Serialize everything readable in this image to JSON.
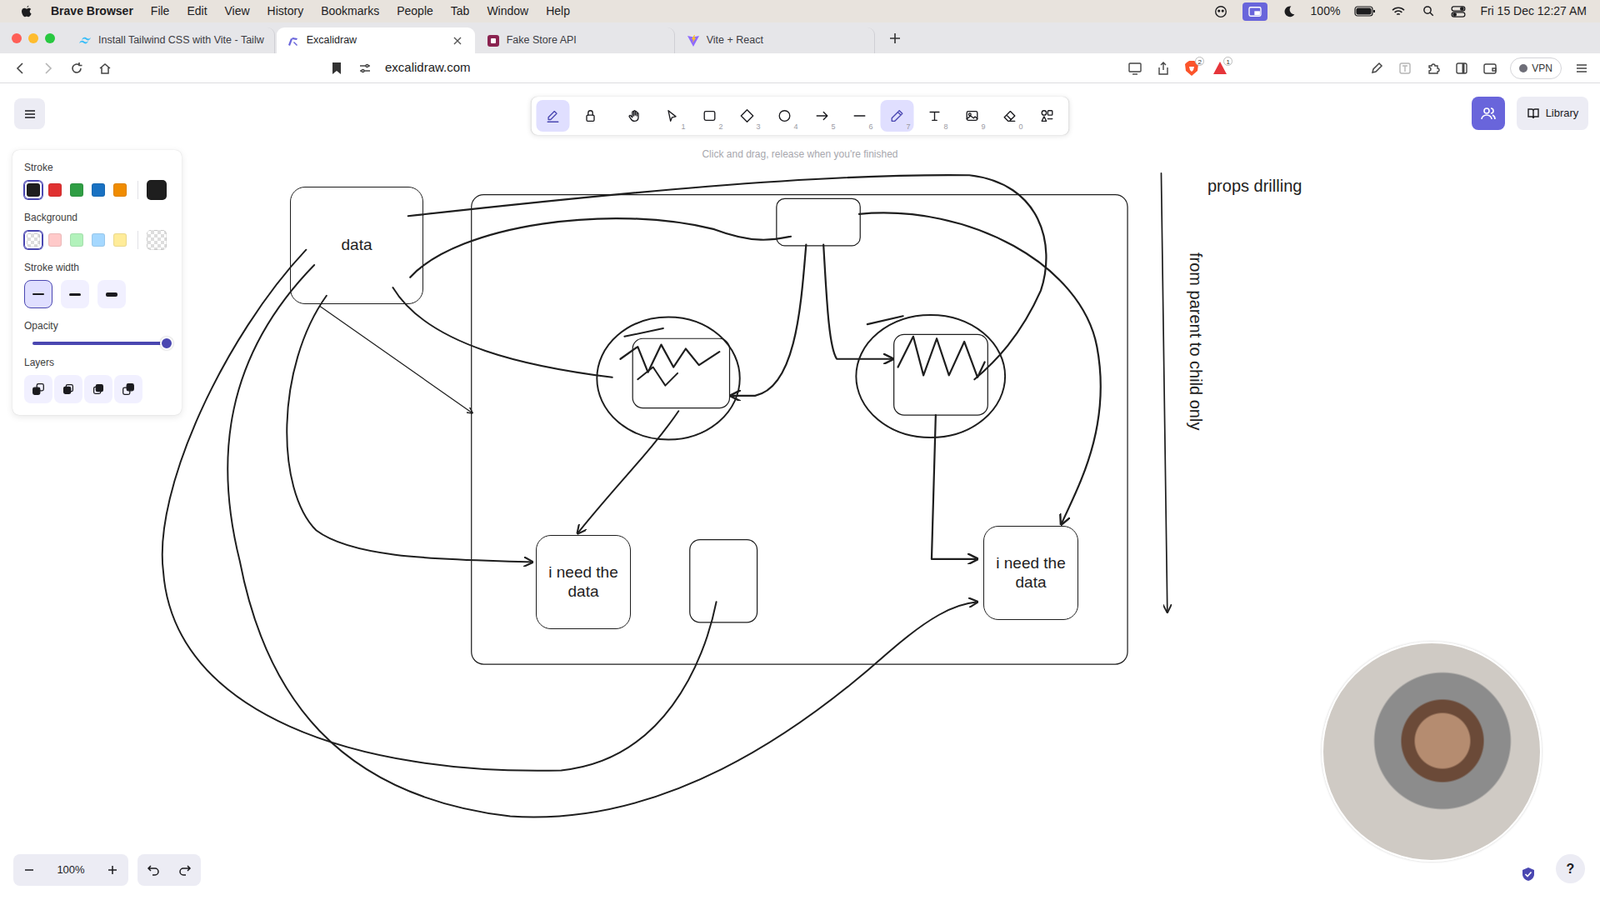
{
  "menubar": {
    "app": "Brave Browser",
    "menus": [
      "File",
      "Edit",
      "View",
      "History",
      "Bookmarks",
      "People",
      "Tab",
      "Window",
      "Help"
    ],
    "battery": "100%",
    "clock": "Fri 15 Dec 12:27 AM"
  },
  "tabs": [
    {
      "label": "Install Tailwind CSS with Vite - Tailw",
      "selected": false,
      "kind": "tailwind"
    },
    {
      "label": "Excalidraw",
      "selected": true,
      "kind": "excalidraw"
    },
    {
      "label": "Fake Store API",
      "selected": false,
      "kind": "fakestore"
    },
    {
      "label": "Vite + React",
      "selected": false,
      "kind": "vite"
    }
  ],
  "addressbar": {
    "url": "excalidraw.com",
    "shields_count": "2",
    "rewards_count": "1",
    "vpn": "VPN"
  },
  "toolbar": {
    "tools": [
      {
        "kind": "pen",
        "selected": true
      },
      {
        "kind": "lock",
        "selected": false
      },
      {
        "kind": "hand",
        "selected": false
      },
      {
        "kind": "select",
        "key": "1",
        "selected": false
      },
      {
        "kind": "rectangle",
        "key": "2",
        "selected": false
      },
      {
        "kind": "diamond",
        "key": "3",
        "selected": false
      },
      {
        "kind": "ellipse",
        "key": "4",
        "selected": false
      },
      {
        "kind": "arrow",
        "key": "5",
        "selected": false
      },
      {
        "kind": "line",
        "key": "6",
        "selected": false
      },
      {
        "kind": "draw",
        "key": "7",
        "selected": true
      },
      {
        "kind": "text",
        "key": "8",
        "selected": false
      },
      {
        "kind": "image",
        "key": "9",
        "selected": false
      },
      {
        "kind": "eraser",
        "key": "0",
        "selected": false
      },
      {
        "kind": "more",
        "selected": false
      }
    ],
    "hint": "Click and drag, release when you're finished"
  },
  "properties": {
    "stroke": {
      "label": "Stroke",
      "swatches": [
        {
          "kind": "color",
          "color": "#1e1e1e",
          "selected": true
        },
        {
          "kind": "color",
          "color": "#e03131",
          "selected": false
        },
        {
          "kind": "color",
          "color": "#2f9e44",
          "selected": false
        },
        {
          "kind": "color",
          "color": "#1971c2",
          "selected": false
        },
        {
          "kind": "color",
          "color": "#f08c00",
          "selected": false
        }
      ],
      "current": {
        "kind": "color",
        "color": "#1e1e1e"
      }
    },
    "background": {
      "label": "Background",
      "swatches": [
        {
          "kind": "transparent",
          "selected": true
        },
        {
          "kind": "color",
          "color": "#ffc9c9",
          "selected": false
        },
        {
          "kind": "color",
          "color": "#b2f2bb",
          "selected": false
        },
        {
          "kind": "color",
          "color": "#a5d8ff",
          "selected": false
        },
        {
          "kind": "color",
          "color": "#ffec99",
          "selected": false
        }
      ],
      "current": {
        "kind": "transparent"
      }
    },
    "stroke_width": {
      "label": "Stroke width",
      "options": [
        {
          "selected": true
        },
        {
          "selected": false
        },
        {
          "selected": false
        }
      ]
    },
    "opacity": {
      "label": "Opacity",
      "level": 1
    },
    "layers": {
      "label": "Layers"
    }
  },
  "library": {
    "label": "Library"
  },
  "zoom": {
    "level": "100%"
  },
  "help": {
    "label": "?"
  },
  "canvas": {
    "nodes": [
      {
        "label": "data"
      },
      {
        "label": "i need the data"
      },
      {
        "label": "i need the data"
      }
    ],
    "notes": [
      {
        "label": "props drilling",
        "kind": "horizontal"
      },
      {
        "label": "from parent to child only",
        "kind": "vertical"
      }
    ]
  }
}
